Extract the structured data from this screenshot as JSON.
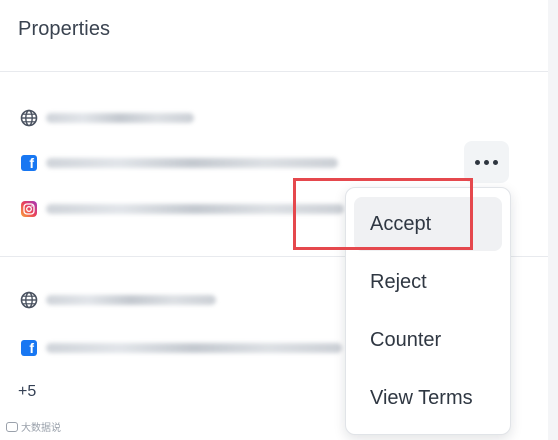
{
  "panel": {
    "title": "Properties"
  },
  "groups": [
    {
      "rows": [
        {
          "icon": "globe-icon"
        },
        {
          "icon": "facebook-icon"
        },
        {
          "icon": "instagram-icon"
        }
      ]
    },
    {
      "rows": [
        {
          "icon": "globe-icon"
        },
        {
          "icon": "facebook-icon"
        }
      ],
      "more_count": "+5"
    }
  ],
  "more_button": {
    "icon": "more-horizontal-icon"
  },
  "menu": {
    "items": [
      {
        "label": "Accept",
        "active": true
      },
      {
        "label": "Reject"
      },
      {
        "label": "Counter"
      },
      {
        "label": "View Terms"
      }
    ]
  },
  "annotation": {
    "color": "#e5484d",
    "target": "Accept"
  },
  "watermark": {
    "text": "大数据说"
  },
  "colors": {
    "facebook": "#1877f2",
    "menu_hover": "#f0f1f3",
    "text": "#344054"
  }
}
